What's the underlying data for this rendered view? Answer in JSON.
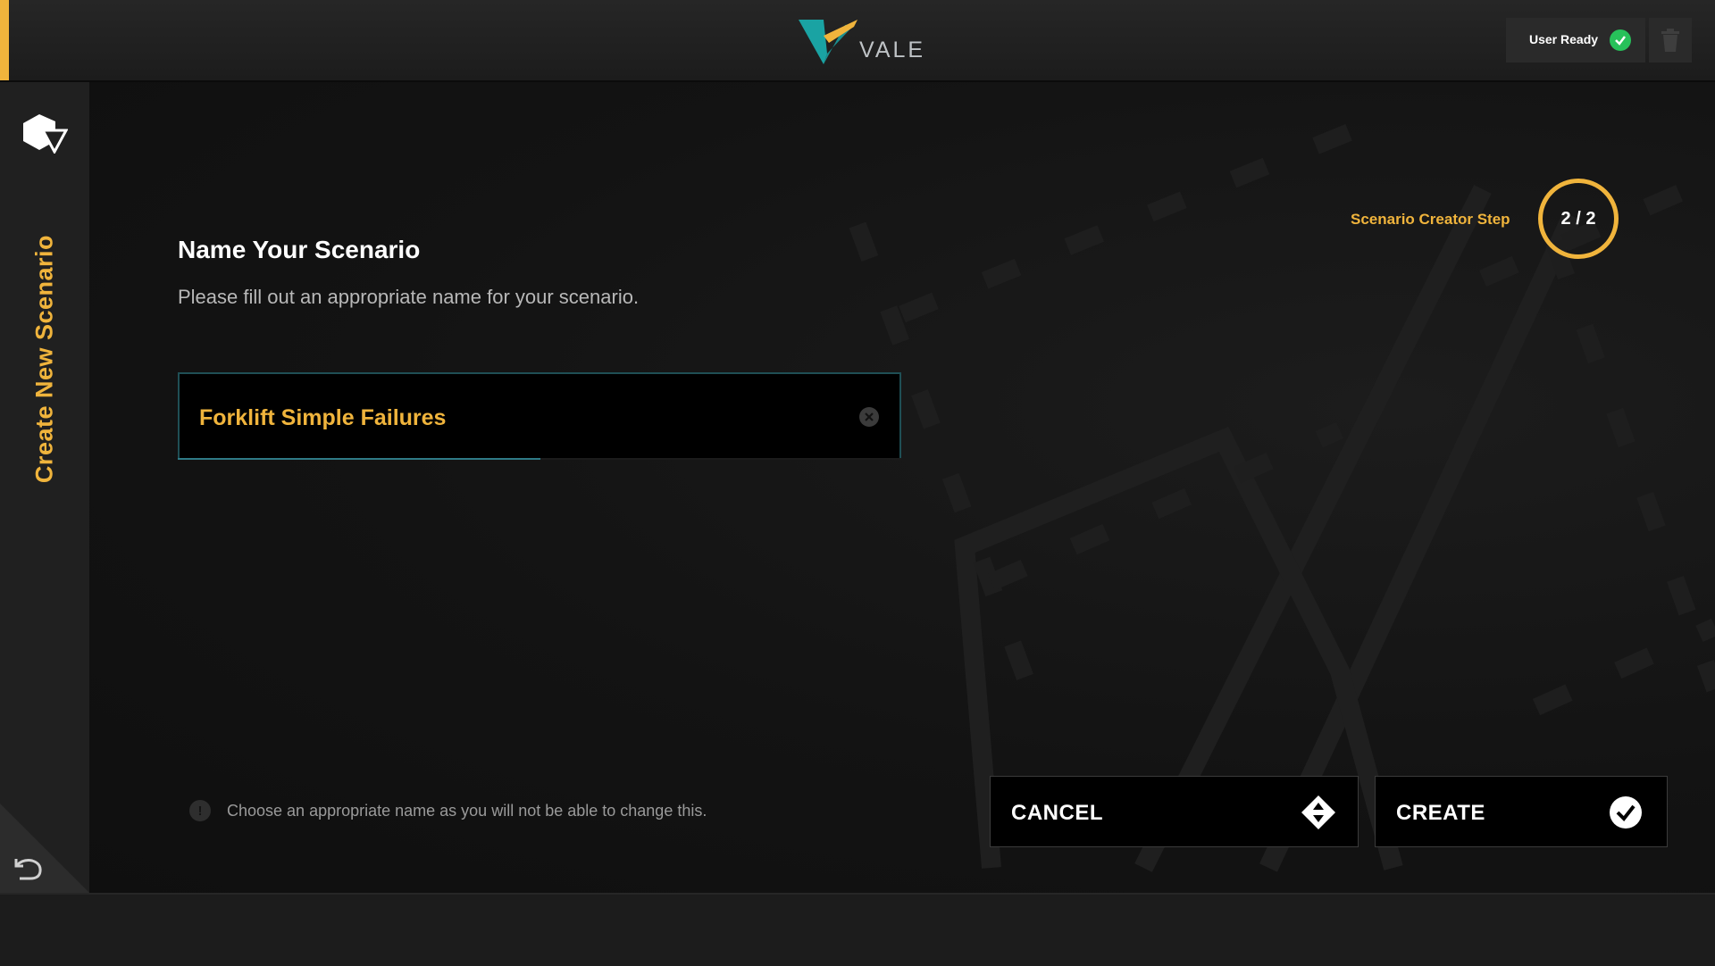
{
  "header": {
    "logo_text": "VALE",
    "user_status": "User Ready",
    "colors": {
      "accent": "#f0b43c",
      "ready": "#27c15a",
      "logo_teal": "#1aa3a3"
    }
  },
  "sidebar": {
    "title": "Create New Scenario",
    "icons": {
      "top": "scenario-shape-icon",
      "bottom": "back-arrow-icon"
    }
  },
  "step": {
    "label": "Scenario Creator Step",
    "count": "2 / 2"
  },
  "form": {
    "title": "Name Your Scenario",
    "subtitle": "Please fill out an appropriate name for your scenario.",
    "name_value": "Forklift Simple Failures",
    "hint": "Choose an appropriate name as you will not be able to change this."
  },
  "actions": {
    "cancel_label": "CANCEL",
    "create_label": "CREATE"
  }
}
